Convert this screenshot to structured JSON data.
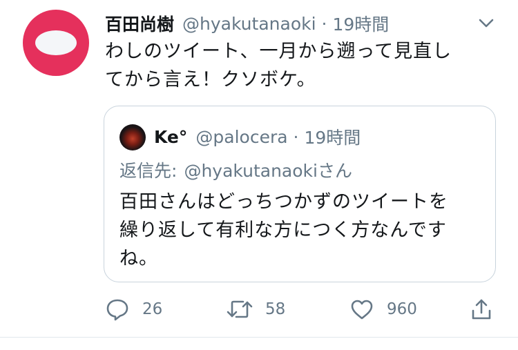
{
  "tweet": {
    "display_name": "百田尚樹",
    "handle": "@hyakutanaoki",
    "separator": "·",
    "time": "19時間",
    "text_lines": [
      "わしのツイート、一月から遡って見直し",
      "てから言え！クソボケ。"
    ]
  },
  "quoted": {
    "display_name": "Ke°",
    "handle": "@palocera",
    "separator": "·",
    "time": "19時間",
    "reply_prefix": "返信先:",
    "reply_mention": "@hyakutanaokiさん",
    "text_lines": [
      "百田さんはどっちつかずのツイートを",
      "繰り返して有利な方につく方なんです",
      "ね。"
    ]
  },
  "actions": {
    "replies": "26",
    "retweets": "58",
    "likes": "960"
  },
  "icons": {
    "reply": "speech-bubble-icon",
    "retweet": "retweet-icon",
    "like": "heart-icon",
    "share": "share-icon",
    "menu": "chevron-down-icon"
  },
  "colors": {
    "text": "#14171a",
    "secondary": "#657786",
    "avatar": "#e5305c",
    "border": "#c8d3dc"
  }
}
